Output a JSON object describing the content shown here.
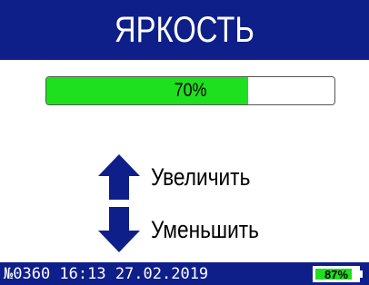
{
  "header": {
    "title": "ЯРКОСТЬ"
  },
  "brightness": {
    "level": 0.7,
    "label": "70%"
  },
  "actions": {
    "increase_label": "Увеличить",
    "decrease_label": "Уменьшить"
  },
  "status_bar": {
    "text": "№0360 16:13 27.02.2019",
    "battery_label": "87%",
    "battery_level": 0.87
  },
  "icons": {
    "increase": "arrow-up-icon",
    "decrease": "arrow-down-icon"
  },
  "colors": {
    "bar_background": "#0f1f8a",
    "fill_green": "#1ee01e",
    "arrow_blue": "#0f1f8a",
    "text_white": "#ffffff"
  }
}
